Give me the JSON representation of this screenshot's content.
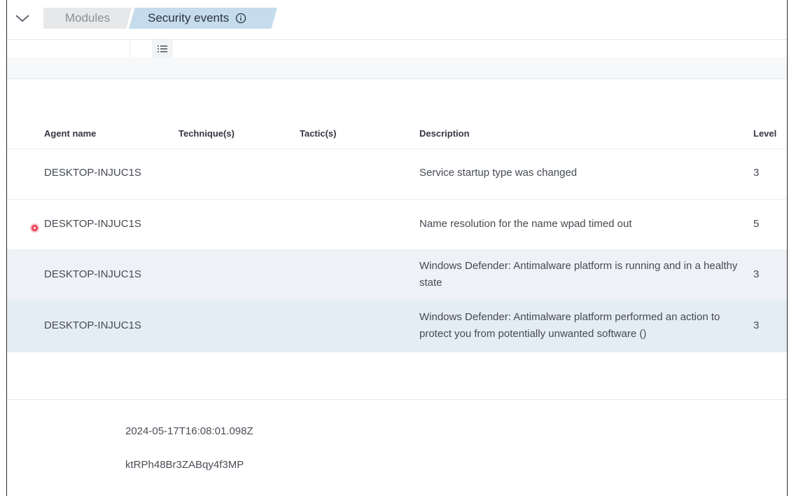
{
  "breadcrumb": {
    "parent_label": "Modules",
    "current_label": "Security events"
  },
  "table": {
    "headers": {
      "agent": "Agent name",
      "technique": "Technique(s)",
      "tactic": "Tactic(s)",
      "description": "Description",
      "level": "Level"
    },
    "rows": [
      {
        "agent": "DESKTOP-INJUC1S",
        "technique": "",
        "tactic": "",
        "description": "Service startup type was changed",
        "level": "3"
      },
      {
        "agent": "DESKTOP-INJUC1S",
        "technique": "",
        "tactic": "",
        "description": "Name resolution for the name wpad timed out",
        "level": "5"
      },
      {
        "agent": "DESKTOP-INJUC1S",
        "technique": "",
        "tactic": "",
        "description": "Windows Defender: Antimalware platform is running and in a healthy state",
        "level": "3"
      },
      {
        "agent": "DESKTOP-INJUC1S",
        "technique": "",
        "tactic": "",
        "description": "Windows Defender: Antimalware platform performed an action to protect you from potentially unwanted software ()",
        "level": "3"
      }
    ]
  },
  "detail": {
    "timestamp": "2024-05-17T16:08:01.098Z",
    "id": "ktRPh48Br3ZABqy4f3MP"
  },
  "colors": {
    "current_crumb_bg": "#c5dcec",
    "parent_crumb_bg": "#e6e8ea",
    "marker": "#e8435b"
  }
}
